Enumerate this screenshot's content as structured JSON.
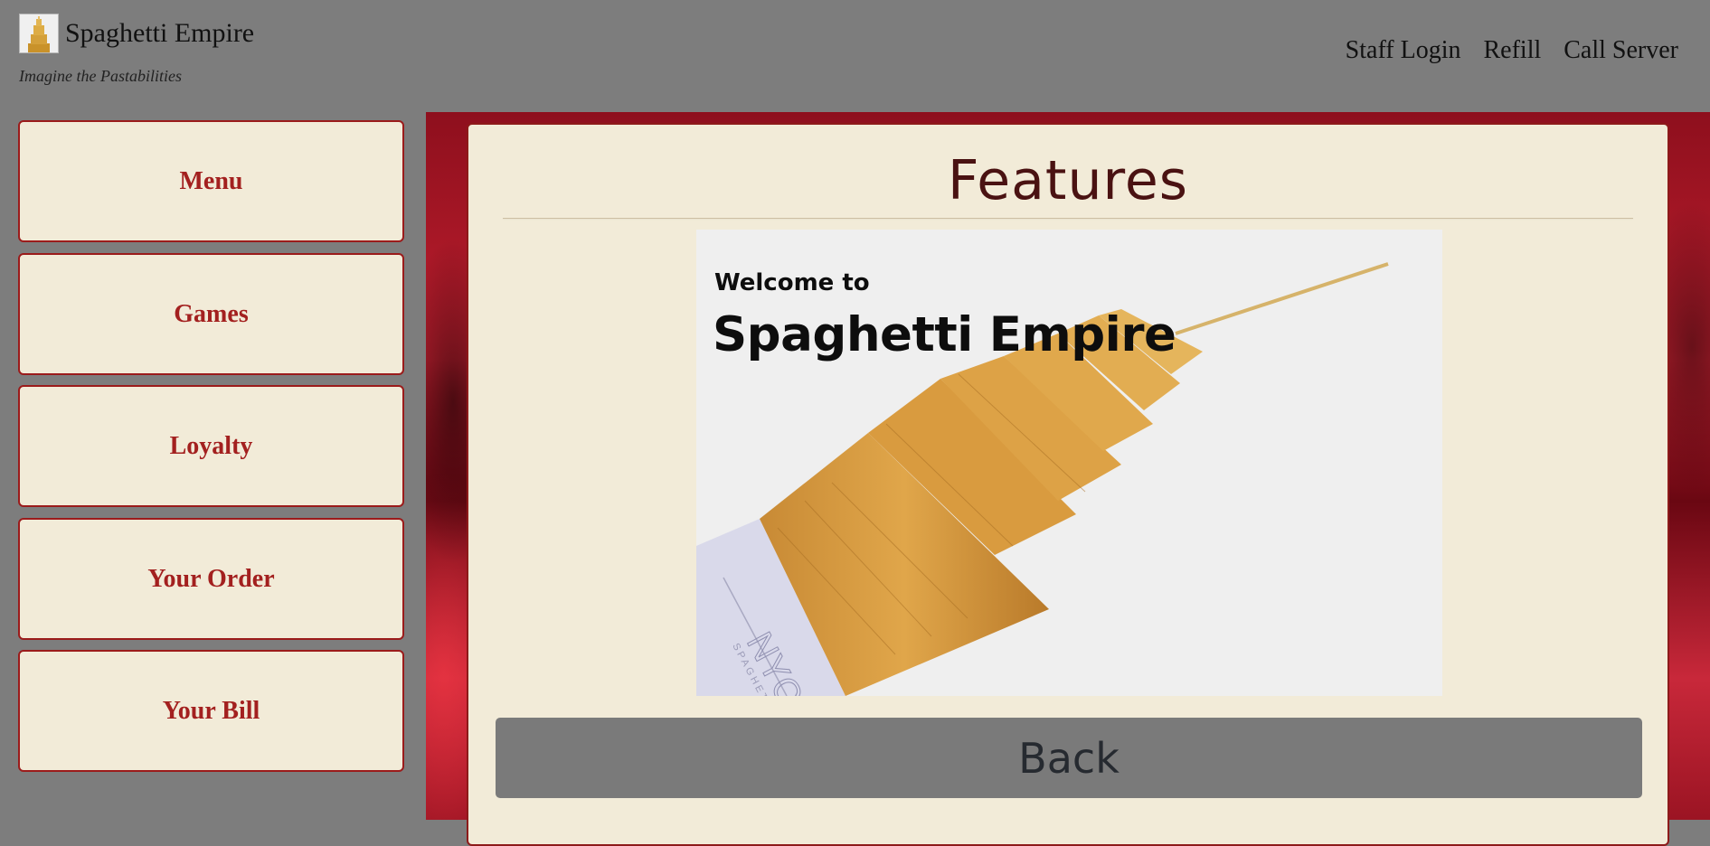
{
  "header": {
    "title": "Spaghetti Empire",
    "tagline": "Imagine the Pastabilities",
    "logo_icon": "spaghetti-tower-icon",
    "nav": [
      "Staff Login",
      "Refill",
      "Call Server"
    ]
  },
  "sidebar": {
    "items": [
      {
        "label": "Menu"
      },
      {
        "label": "Games"
      },
      {
        "label": "Loyalty"
      },
      {
        "label": "Your Order"
      },
      {
        "label": "Your Bill"
      }
    ]
  },
  "main": {
    "title": "Features",
    "feature_image": {
      "line1": "Welcome to",
      "line2": "Spaghetti Empire",
      "package_text": "NYC",
      "package_subtext": "SPAGHETTI"
    },
    "back_label": "Back"
  },
  "colors": {
    "page_bg": "#7d7d7d",
    "panel_bg": "#f2ebd8",
    "accent_red": "#a3201f",
    "title_color": "#4a1212"
  }
}
